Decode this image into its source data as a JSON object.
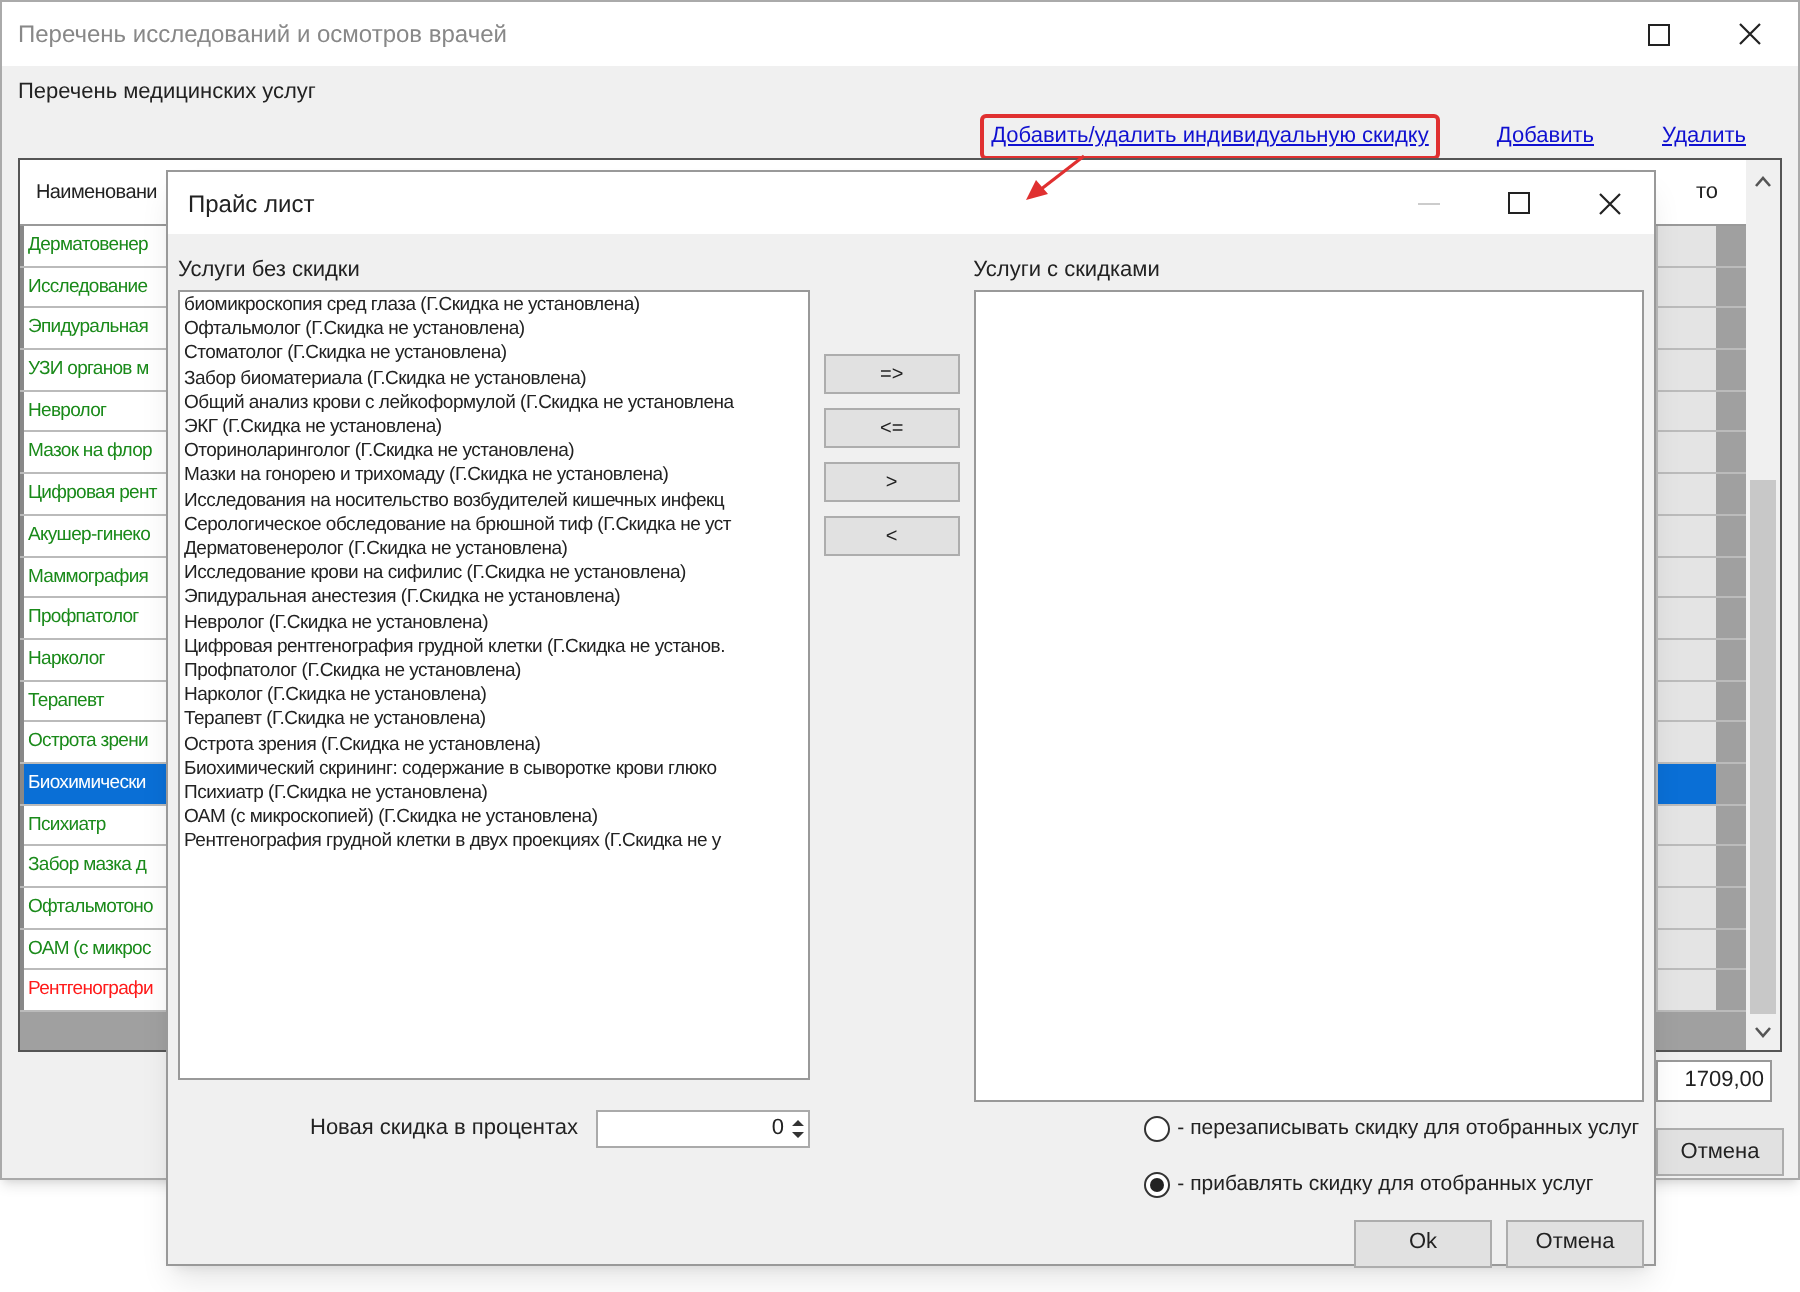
{
  "main_window": {
    "title": "Перечень исследований и осмотров врачей",
    "section_label": "Перечень медицинских услуг",
    "links": [
      {
        "label": "Добавить/удалить индивидуальную скидку",
        "highlighted": true
      },
      {
        "label": "Добавить",
        "highlighted": false
      },
      {
        "label": "Удалить",
        "highlighted": false
      }
    ],
    "table": {
      "columns": [
        "Наименовани",
        "то"
      ],
      "rows": [
        {
          "name": "Дерматовенер",
          "color": "#1a8a1a",
          "selected": false
        },
        {
          "name": "Исследование",
          "color": "#1a8a1a",
          "selected": false
        },
        {
          "name": "Эпидуральная",
          "color": "#1a8a1a",
          "selected": false
        },
        {
          "name": "УЗИ органов м",
          "color": "#1a8a1a",
          "selected": false
        },
        {
          "name": "Невролог",
          "color": "#1a8a1a",
          "selected": false
        },
        {
          "name": "Мазок на флор",
          "color": "#1a8a1a",
          "selected": false
        },
        {
          "name": "Цифровая рент",
          "color": "#1a8a1a",
          "selected": false
        },
        {
          "name": "Акушер-гинеко",
          "color": "#1a8a1a",
          "selected": false
        },
        {
          "name": "Маммография",
          "color": "#1a8a1a",
          "selected": false
        },
        {
          "name": "Профпатолог",
          "color": "#1a8a1a",
          "selected": false
        },
        {
          "name": "Нарколог",
          "color": "#1a8a1a",
          "selected": false
        },
        {
          "name": "Терапевт",
          "color": "#1a8a1a",
          "selected": false
        },
        {
          "name": "Острота зрени",
          "color": "#1a8a1a",
          "selected": false
        },
        {
          "name": "Биохимически",
          "selected": true
        },
        {
          "name": "Психиатр",
          "color": "#1a8a1a",
          "selected": false
        },
        {
          "name": "Забор мазка д",
          "color": "#1a8a1a",
          "selected": false
        },
        {
          "name": "Офтальмотоно",
          "color": "#1a8a1a",
          "selected": false
        },
        {
          "name": "ОАМ (с микрос",
          "color": "#1a8a1a",
          "selected": false
        },
        {
          "name": "Рентгенографи",
          "color": "#ff1a1a",
          "selected": false
        }
      ]
    },
    "total": "1709,00",
    "cancel_button": "Отмена"
  },
  "dialog": {
    "title": "Прайс лист",
    "left_label": "Услуги без скидки",
    "left_list": [
      "биомикроскопия сред глаза (Г.Скидка не установлена)",
      "Офтальмолог (Г.Скидка не установлена)",
      "Стоматолог (Г.Скидка не установлена)",
      "Забор биоматериала (Г.Скидка не установлена)",
      "Общий анализ крови с лейкоформулой (Г.Скидка не установлена",
      "ЭКГ (Г.Скидка не установлена)",
      "Оториноларинголог (Г.Скидка не установлена)",
      "Мазки на гонорею и трихомаду (Г.Скидка не установлена)",
      "Исследования на носительство возбудителей кишечных инфекц",
      "Серологическое обследование на брюшной тиф (Г.Скидка не уст",
      "Дерматовенеролог (Г.Скидка не установлена)",
      "Исследование крови на сифилис (Г.Скидка не установлена)",
      "Эпидуральная анестезия (Г.Скидка не установлена)",
      "Невролог (Г.Скидка не установлена)",
      "Цифровая рентгенография грудной клетки (Г.Скидка не установ.",
      "Профпатолог (Г.Скидка не установлена)",
      "Нарколог (Г.Скидка не установлена)",
      "Терапевт (Г.Скидка не установлена)",
      "Острота зрения (Г.Скидка не установлена)",
      "Биохимический скрининг: содержание в сыворотке крови глюко",
      "Психиатр (Г.Скидка не установлена)",
      "ОАМ (с микроскопией) (Г.Скидка не установлена)",
      "Рентгенография грудной клетки в двух проекциях (Г.Скидка не у"
    ],
    "move_buttons": [
      "=>",
      "<=",
      ">",
      "<"
    ],
    "right_label": "Услуги с скидками",
    "discount_label": "Новая скидка в процентах",
    "discount_value": "0",
    "options": [
      {
        "label": "- перезаписывать скидку для отобранных услуг",
        "selected": false
      },
      {
        "label": "- прибавлять скидку для отобранных услуг",
        "selected": true
      }
    ],
    "buttons": [
      "Ok",
      "Отмена"
    ]
  }
}
